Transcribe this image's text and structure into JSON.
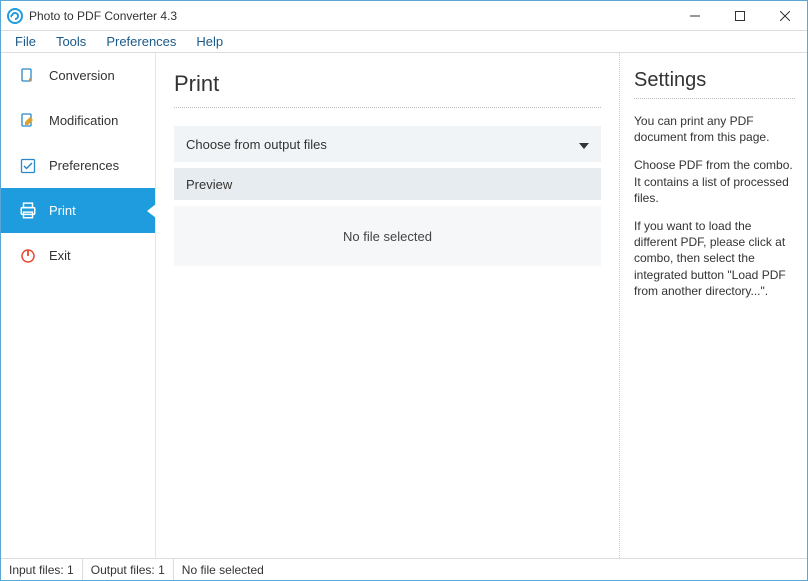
{
  "titlebar": {
    "title": "Photo to PDF Converter 4.3"
  },
  "menubar": {
    "items": [
      "File",
      "Tools",
      "Preferences",
      "Help"
    ]
  },
  "sidebar": {
    "items": [
      {
        "label": "Conversion",
        "icon": "conversion-icon",
        "active": false
      },
      {
        "label": "Modification",
        "icon": "modification-icon",
        "active": false
      },
      {
        "label": "Preferences",
        "icon": "preferences-icon",
        "active": false
      },
      {
        "label": "Print",
        "icon": "print-icon",
        "active": true
      },
      {
        "label": "Exit",
        "icon": "exit-icon",
        "active": false
      }
    ]
  },
  "main": {
    "heading": "Print",
    "combo_label": "Choose from output files",
    "preview_heading": "Preview",
    "preview_message": "No file selected"
  },
  "settings": {
    "heading": "Settings",
    "p1": "You can print any PDF document from this page.",
    "p2": "Choose PDF from the combo. It contains a list of processed files.",
    "p3": "If you want to load the different PDF, please click at combo, then select the integrated button \"Load PDF from another directory...\"."
  },
  "statusbar": {
    "input_label": "Input files:",
    "input_value": "1",
    "output_label": "Output files:",
    "output_value": "1",
    "selection": "No file selected"
  }
}
